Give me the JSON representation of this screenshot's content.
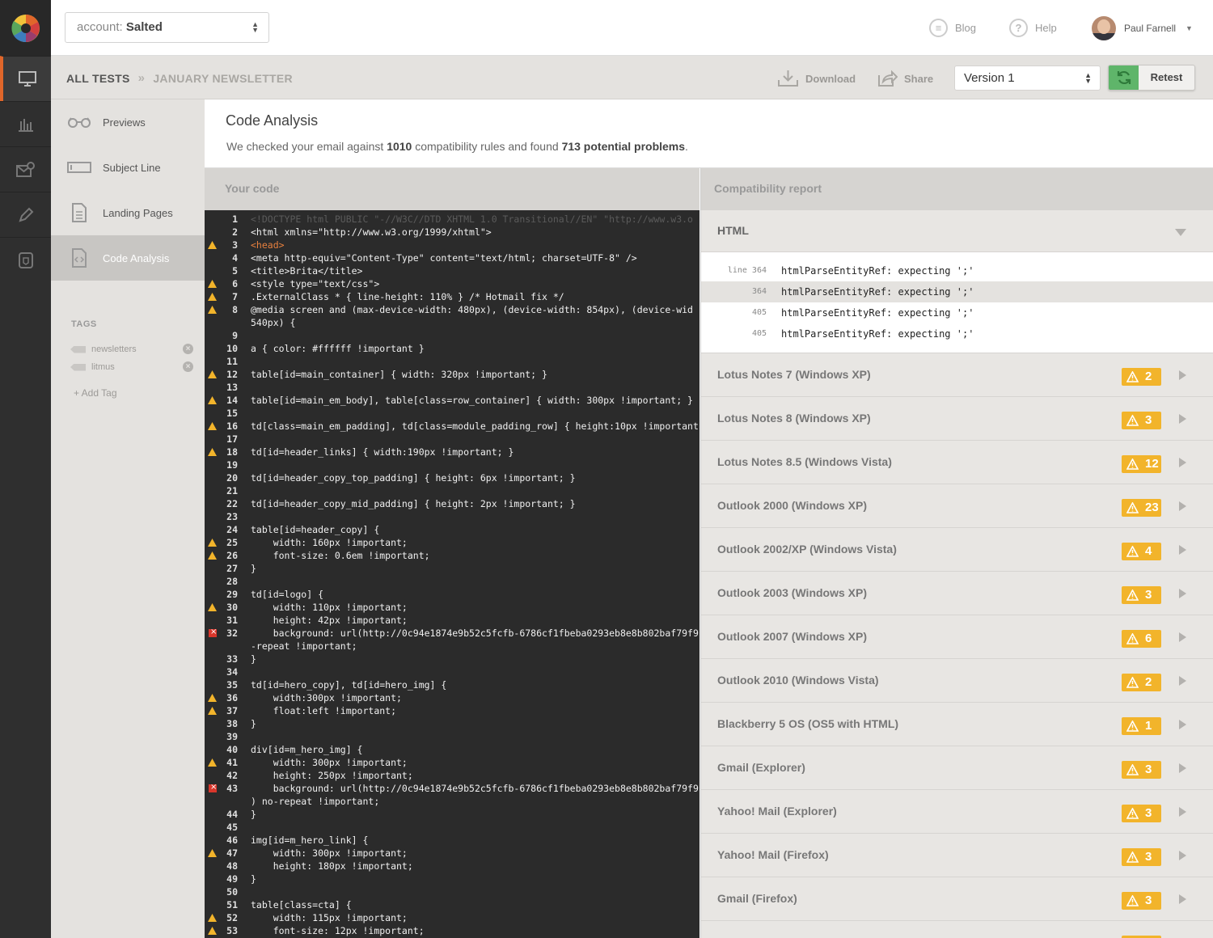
{
  "account": {
    "prefix": "account:",
    "name": "Salted"
  },
  "topnav": {
    "blog": "Blog",
    "help": "Help",
    "user": "Paul Farnell"
  },
  "breadcrumb": {
    "root": "ALL TESTS",
    "current": "JANUARY NEWSLETTER"
  },
  "actions": {
    "download": "Download",
    "share": "Share",
    "version": "Version 1",
    "retest": "Retest"
  },
  "sidebar": {
    "items": [
      {
        "label": "Previews",
        "icon": "glasses-icon"
      },
      {
        "label": "Subject Line",
        "icon": "subject-line-icon"
      },
      {
        "label": "Landing Pages",
        "icon": "document-icon"
      },
      {
        "label": "Code Analysis",
        "icon": "code-file-icon"
      }
    ],
    "tags_title": "TAGS",
    "tags": [
      "newsletters",
      "litmus"
    ],
    "add_tag": "+ Add Tag"
  },
  "rail": [
    "desktop-icon",
    "bar-chart-icon",
    "envelope-check-icon",
    "pencil-icon",
    "shield-icon"
  ],
  "main": {
    "title": "Code Analysis",
    "desc_prefix": "We checked your email against",
    "rules": "1010",
    "desc_mid": "compatibility rules and found",
    "problems": "713 potential problems",
    "desc_end": "."
  },
  "code": {
    "header": "Your code",
    "lines": [
      {
        "n": "1",
        "t": "<!DOCTYPE html PUBLIC \"-//W3C//DTD XHTML 1.0 Transitional//EN\" \"http://www.w3.o",
        "k": "cm"
      },
      {
        "n": "2",
        "t": "<html xmlns=\"http://www.w3.org/1999/xhtml\">"
      },
      {
        "n": "3",
        "t": "<head>",
        "m": "w",
        "k": "ct"
      },
      {
        "n": "4",
        "t": "<meta http-equiv=\"Content-Type\" content=\"text/html; charset=UTF-8\" />"
      },
      {
        "n": "5",
        "t": "<title>Brita</title>"
      },
      {
        "n": "6",
        "t": "<style type=\"text/css\">",
        "m": "w"
      },
      {
        "n": "7",
        "t": ".ExternalClass * { line-height: 110% } /* Hotmail fix */",
        "m": "w"
      },
      {
        "n": "8",
        "t": "@media screen and (max-device-width: 480px), (device-width: 854px), (device-wid",
        "m": "w",
        "k": "ca"
      },
      {
        "n": "",
        "t": "540px) {",
        "k": "ca"
      },
      {
        "n": "9",
        "t": ""
      },
      {
        "n": "10",
        "t": "a { color: #ffffff !important }"
      },
      {
        "n": "11",
        "t": ""
      },
      {
        "n": "12",
        "t": "table[id=main_container] { width: 320px !important; }",
        "m": "w"
      },
      {
        "n": "13",
        "t": ""
      },
      {
        "n": "14",
        "t": "table[id=main_em_body], table[class=row_container] { width: 300px !important; }",
        "m": "w"
      },
      {
        "n": "15",
        "t": ""
      },
      {
        "n": "16",
        "t": "td[class=main_em_padding], td[class=module_padding_row] { height:10px !important",
        "m": "w"
      },
      {
        "n": "17",
        "t": ""
      },
      {
        "n": "18",
        "t": "td[id=header_links] { width:190px !important; }",
        "m": "w"
      },
      {
        "n": "19",
        "t": ""
      },
      {
        "n": "20",
        "t": "td[id=header_copy_top_padding] { height: 6px !important; }"
      },
      {
        "n": "21",
        "t": ""
      },
      {
        "n": "22",
        "t": "td[id=header_copy_mid_padding] { height: 2px !important; }"
      },
      {
        "n": "23",
        "t": ""
      },
      {
        "n": "24",
        "t": "table[id=header_copy] {"
      },
      {
        "n": "25",
        "t": "    width: 160px !important;",
        "m": "w"
      },
      {
        "n": "26",
        "t": "    font-size: 0.6em !important;",
        "m": "w"
      },
      {
        "n": "27",
        "t": "}"
      },
      {
        "n": "28",
        "t": ""
      },
      {
        "n": "29",
        "t": "td[id=logo] {"
      },
      {
        "n": "30",
        "t": "    width: 110px !important;",
        "m": "w"
      },
      {
        "n": "31",
        "t": "    height: 42px !important;"
      },
      {
        "n": "32",
        "t": "    background: url(http://0c94e1874e9b52c5fcfb-6786cf1fbeba0293eb8e8b802baf79f9",
        "m": "e"
      },
      {
        "n": "",
        "t": "-repeat !important;"
      },
      {
        "n": "33",
        "t": "}"
      },
      {
        "n": "34",
        "t": ""
      },
      {
        "n": "35",
        "t": "td[id=hero_copy], td[id=hero_img] {"
      },
      {
        "n": "36",
        "t": "    width:300px !important;",
        "m": "w"
      },
      {
        "n": "37",
        "t": "    float:left !important;",
        "m": "w"
      },
      {
        "n": "38",
        "t": "}"
      },
      {
        "n": "39",
        "t": ""
      },
      {
        "n": "40",
        "t": "div[id=m_hero_img] {"
      },
      {
        "n": "41",
        "t": "    width: 300px !important;",
        "m": "w"
      },
      {
        "n": "42",
        "t": "    height: 250px !important;"
      },
      {
        "n": "43",
        "t": "    background: url(http://0c94e1874e9b52c5fcfb-6786cf1fbeba0293eb8e8b802baf79f9",
        "m": "e"
      },
      {
        "n": "",
        "t": ") no-repeat !important;"
      },
      {
        "n": "44",
        "t": "}"
      },
      {
        "n": "45",
        "t": ""
      },
      {
        "n": "46",
        "t": "img[id=m_hero_link] {"
      },
      {
        "n": "47",
        "t": "    width: 300px !important;",
        "m": "w"
      },
      {
        "n": "48",
        "t": "    height: 180px !important;"
      },
      {
        "n": "49",
        "t": "}"
      },
      {
        "n": "50",
        "t": ""
      },
      {
        "n": "51",
        "t": "table[class=cta] {"
      },
      {
        "n": "52",
        "t": "    width: 115px !important;",
        "m": "w"
      },
      {
        "n": "53",
        "t": "    font-size: 12px !important;",
        "m": "w"
      }
    ]
  },
  "report": {
    "header": "Compatibility report",
    "html_section": "HTML",
    "issues": [
      {
        "label": "line 364",
        "msg": "htmlParseEntityRef: expecting ';'"
      },
      {
        "label": "364",
        "msg": "htmlParseEntityRef: expecting ';'"
      },
      {
        "label": "405",
        "msg": "htmlParseEntityRef: expecting ';'"
      },
      {
        "label": "405",
        "msg": "htmlParseEntityRef: expecting ';'"
      }
    ],
    "clients": [
      {
        "name": "Lotus Notes 7 (Windows XP)",
        "count": "2"
      },
      {
        "name": "Lotus Notes 8 (Windows XP)",
        "count": "3"
      },
      {
        "name": "Lotus Notes 8.5 (Windows Vista)",
        "count": "12"
      },
      {
        "name": "Outlook 2000 (Windows XP)",
        "count": "23"
      },
      {
        "name": "Outlook 2002/XP (Windows Vista)",
        "count": "4"
      },
      {
        "name": "Outlook 2003 (Windows XP)",
        "count": "3"
      },
      {
        "name": "Outlook 2007 (Windows XP)",
        "count": "6"
      },
      {
        "name": "Outlook 2010 (Windows Vista)",
        "count": "2"
      },
      {
        "name": "Blackberry 5 OS (OS5 with HTML)",
        "count": "1"
      },
      {
        "name": "Gmail (Explorer)",
        "count": "3"
      },
      {
        "name": "Yahoo! Mail (Explorer)",
        "count": "3"
      },
      {
        "name": "Yahoo! Mail (Firefox)",
        "count": "3"
      },
      {
        "name": "Gmail (Firefox)",
        "count": "3"
      },
      {
        "name": "",
        "count": ""
      }
    ]
  },
  "colors": {
    "accent": "#e0662a",
    "warning": "#f2b42b",
    "error": "#d9362b",
    "retest": "#5fb56a"
  }
}
